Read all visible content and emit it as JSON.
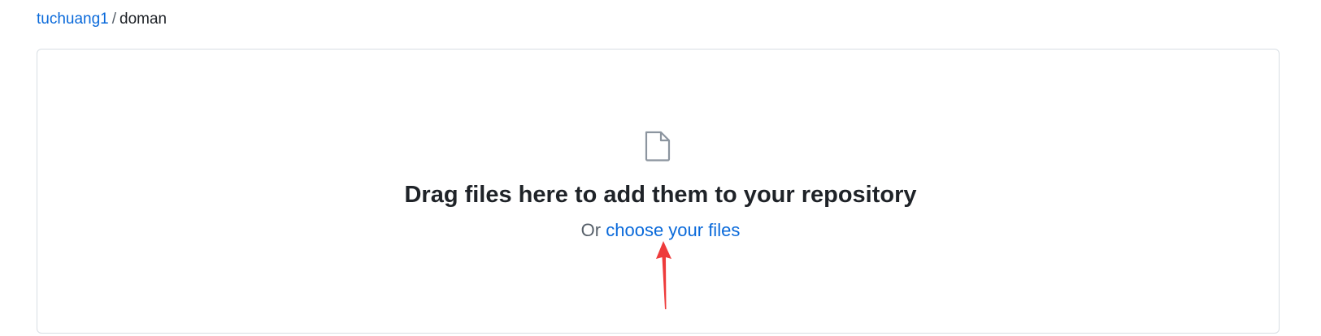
{
  "breadcrumb": {
    "owner": "tuchuang1",
    "separator": "/",
    "repo": "doman"
  },
  "dropzone": {
    "icon": "file-icon",
    "headline": "Drag files here to add them to your repository",
    "prefix": "Or",
    "choose_link": "choose your files"
  },
  "colors": {
    "link": "#0969da",
    "border": "#d8dee4",
    "annotation_arrow": "#ee3b3b"
  }
}
